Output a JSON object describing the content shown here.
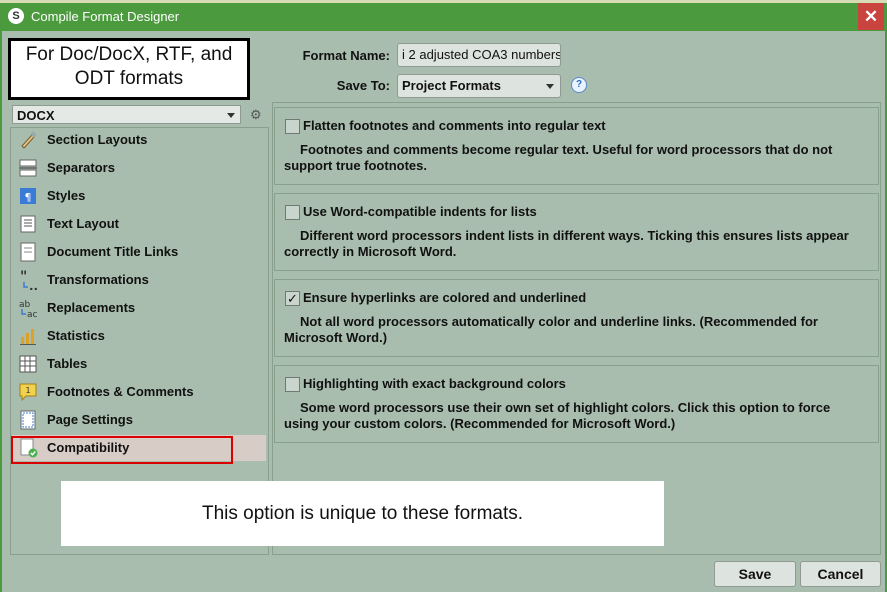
{
  "window": {
    "title": "Compile Format Designer"
  },
  "callouts": {
    "top": "For Doc/DocX, RTF, and ODT formats",
    "bottom": "This option is unique to these formats."
  },
  "format_name": {
    "label": "Format Name:",
    "value": "i 2 adjusted COA3 numbers"
  },
  "save_to": {
    "label": "Save To:",
    "value": "Project Formats"
  },
  "help": "?",
  "format_select": "DOCX",
  "sidebar": {
    "items": [
      {
        "label": "Section Layouts",
        "icon": "paintbrush-icon"
      },
      {
        "label": "Separators",
        "icon": "separator-icon"
      },
      {
        "label": "Styles",
        "icon": "styles-icon"
      },
      {
        "label": "Text Layout",
        "icon": "text-layout-icon"
      },
      {
        "label": "Document Title Links",
        "icon": "document-icon"
      },
      {
        "label": "Transformations",
        "icon": "quotes-icon"
      },
      {
        "label": "Replacements",
        "icon": "replace-icon"
      },
      {
        "label": "Statistics",
        "icon": "bar-chart-icon"
      },
      {
        "label": "Tables",
        "icon": "table-icon"
      },
      {
        "label": "Footnotes & Comments",
        "icon": "footnote-icon"
      },
      {
        "label": "Page Settings",
        "icon": "page-icon"
      },
      {
        "label": "Compatibility",
        "icon": "compatibility-icon"
      }
    ],
    "selected": "Compatibility"
  },
  "options": [
    {
      "title": "Flatten footnotes and comments into regular text",
      "checked": false,
      "desc": "Footnotes and comments become regular text. Useful for word processors that do not support true footnotes."
    },
    {
      "title": "Use Word-compatible indents for lists",
      "checked": false,
      "desc": "Different word processors indent lists in different ways. Ticking this ensures lists appear correctly in Microsoft Word."
    },
    {
      "title": "Ensure hyperlinks are colored and underlined",
      "checked": true,
      "desc": "Not all word processors automatically color and underline links. (Recommended for Microsoft Word.)"
    },
    {
      "title": "Highlighting with exact background colors",
      "checked": false,
      "desc": "Some word processors use their own set of highlight colors. Click this option to force using your custom colors. (Recommended for Microsoft Word.)"
    }
  ],
  "buttons": {
    "save": "Save",
    "cancel": "Cancel"
  },
  "colors": {
    "titlebar": "#4b9a3e",
    "background": "#a9bdae",
    "selection_frame": "#d90000"
  }
}
